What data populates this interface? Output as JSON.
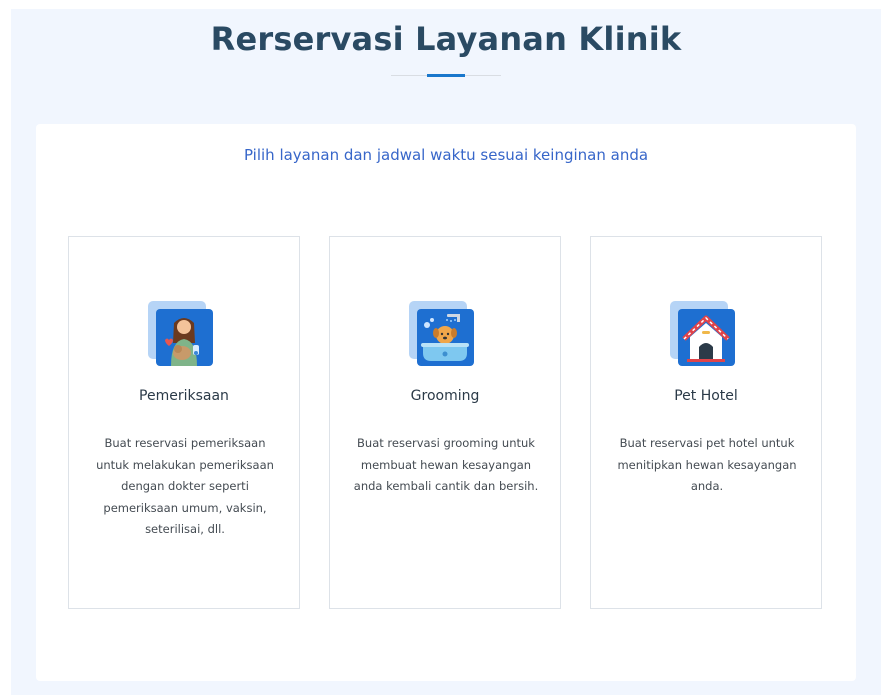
{
  "header": {
    "title": "Rerservasi Layanan Klinik"
  },
  "panel": {
    "subtitle": "Pilih layanan dan jadwal waktu sesuai keinginan anda"
  },
  "services": [
    {
      "icon": "vet-checkup-icon",
      "title": "Pemeriksaan",
      "description": "Buat reservasi pemeriksaan untuk melakukan pemeriksaan dengan dokter seperti pemeriksaan umum, vaksin, seterilisai, dll."
    },
    {
      "icon": "pet-grooming-icon",
      "title": "Grooming",
      "description": "Buat reservasi grooming untuk membuat hewan kesayangan anda kembali cantik dan bersih."
    },
    {
      "icon": "pet-hotel-icon",
      "title": "Pet Hotel",
      "description": "Buat reservasi pet hotel untuk menitipkan hewan kesayangan anda."
    }
  ],
  "colors": {
    "section_bg": "#f1f6fe",
    "title": "#2a4a63",
    "accent": "#1977cc",
    "subtitle": "#3766c9",
    "icon_bg": "#1e6fd1"
  }
}
